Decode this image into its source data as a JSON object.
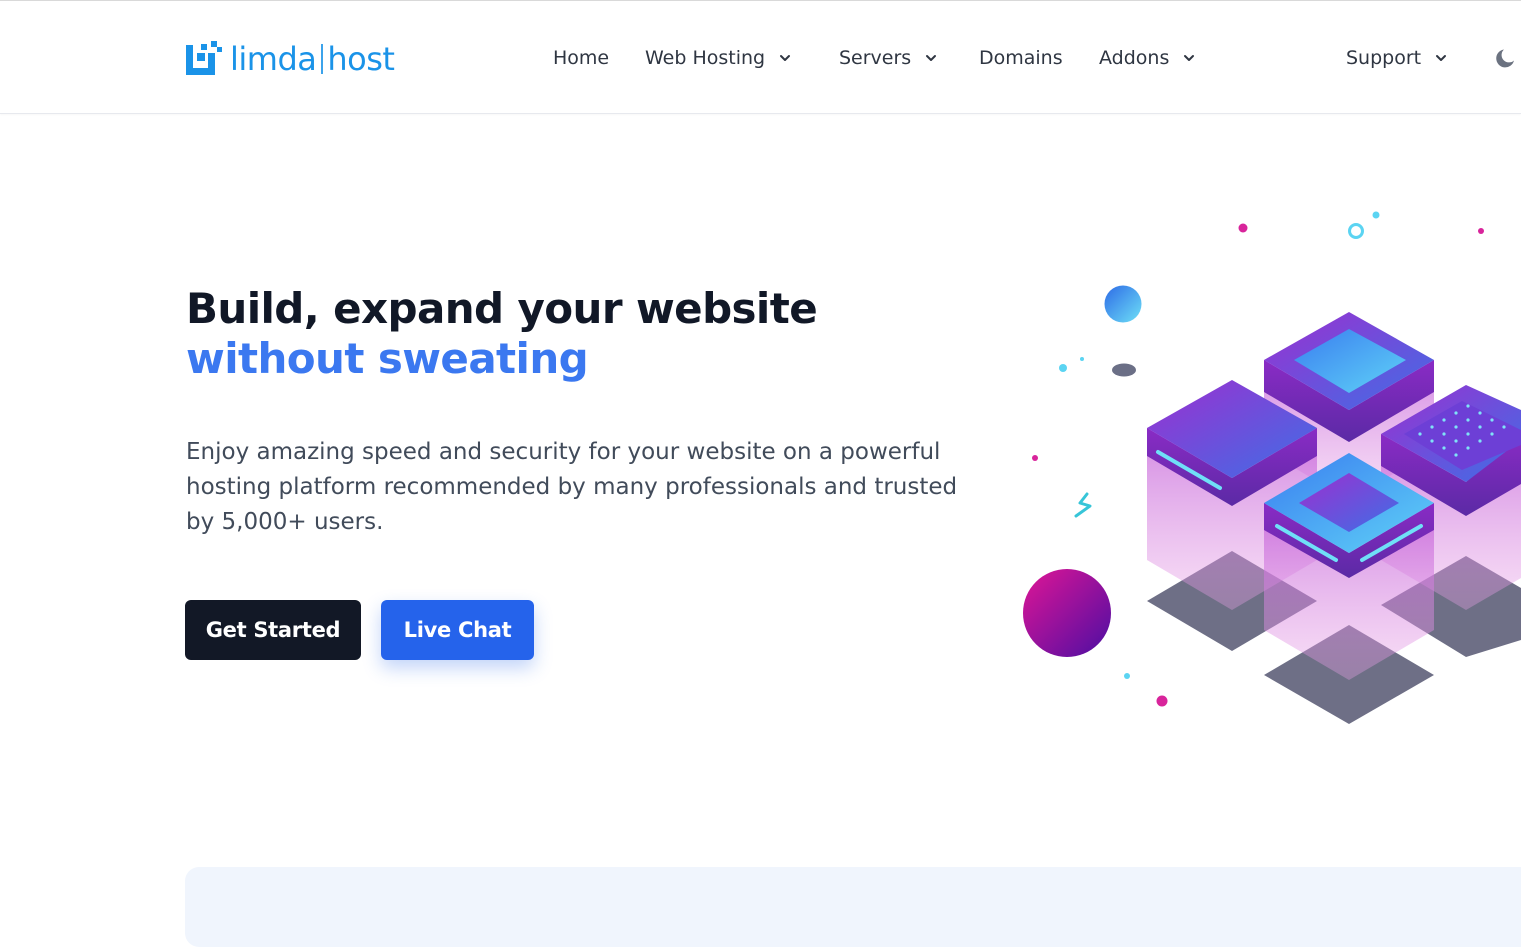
{
  "brand": {
    "name_left": "limda",
    "name_right": "host",
    "logo_icon": "limda-logo-icon",
    "color": "#1a93e8"
  },
  "nav": {
    "items": [
      {
        "label": "Home",
        "has_dropdown": false
      },
      {
        "label": "Web Hosting",
        "has_dropdown": true
      },
      {
        "label": "Servers",
        "has_dropdown": true
      },
      {
        "label": "Domains",
        "has_dropdown": false
      },
      {
        "label": "Addons",
        "has_dropdown": true
      },
      {
        "label": "Support",
        "has_dropdown": true
      }
    ],
    "theme_toggle_icon": "moon-icon"
  },
  "hero": {
    "title_line1": "Build, expand your website",
    "title_line2": "without sweating",
    "description": "Enjoy amazing speed and security for your website on a powerful hosting platform recommended by many professionals and trusted by 5,000+ users.",
    "primary_button": "Get Started",
    "secondary_button": "Live Chat",
    "illustration": "isometric-server-stack-illustration"
  },
  "colors": {
    "accent": "#3b78f0",
    "primary_button_bg": "#121826",
    "secondary_button_bg": "#2563eb",
    "panel_bg": "#f0f5fd"
  }
}
